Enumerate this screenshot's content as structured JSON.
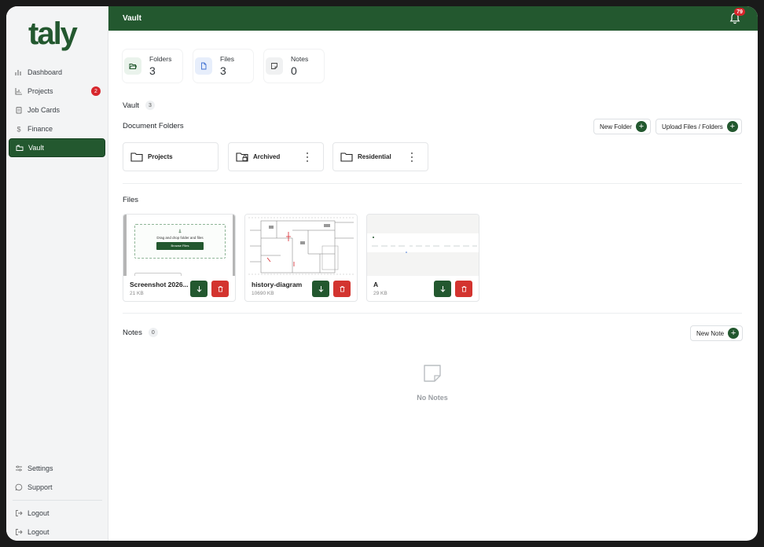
{
  "sidebar": {
    "logo": "taly",
    "items": [
      {
        "label": "Dashboard",
        "icon": "bar-chart-icon"
      },
      {
        "label": "Projects",
        "icon": "projects-chart-icon",
        "badge": "2"
      },
      {
        "label": "Job Cards",
        "icon": "clipboard-icon"
      },
      {
        "label": "Finance",
        "icon": "dollar-icon"
      },
      {
        "label": "Vault",
        "icon": "vault-folders-icon",
        "active": true
      }
    ],
    "bottom": [
      {
        "label": "Settings",
        "icon": "sliders-icon"
      },
      {
        "label": "Support",
        "icon": "chat-icon"
      },
      {
        "label": "Logout",
        "icon": "logout-icon"
      },
      {
        "label": "Logout",
        "icon": "logout-icon"
      }
    ]
  },
  "header": {
    "title": "Vault",
    "notifications": "79"
  },
  "stats": [
    {
      "label": "Folders",
      "value": "3",
      "icon": "folder-open-icon"
    },
    {
      "label": "Files",
      "value": "3",
      "icon": "file-icon"
    },
    {
      "label": "Notes",
      "value": "0",
      "icon": "note-icon"
    }
  ],
  "vault": {
    "title": "Vault",
    "count": "3"
  },
  "folders_section": {
    "title": "Document Folders",
    "new_folder_label": "New Folder",
    "upload_label": "Upload Files / Folders",
    "folders": [
      {
        "name": "Projects",
        "locked": false,
        "menu": false
      },
      {
        "name": "Archived",
        "locked": true,
        "menu": true
      },
      {
        "name": "Residential",
        "locked": false,
        "menu": true
      }
    ]
  },
  "files_section": {
    "title": "Files",
    "files": [
      {
        "name": "Screenshot 2026...",
        "size": "21 KB",
        "thumb_upload_text": "Drag and drop folder and files",
        "thumb_button": "Browse Files"
      },
      {
        "name": "history-diagram",
        "size": "10690 KB"
      },
      {
        "name": "A",
        "size": "29 KB"
      }
    ]
  },
  "notes_section": {
    "title": "Notes",
    "count": "0",
    "new_note_label": "New Note",
    "empty_text": "No Notes"
  },
  "colors": {
    "brand": "#23582f",
    "danger": "#d3342f",
    "badge": "#d7262c"
  }
}
